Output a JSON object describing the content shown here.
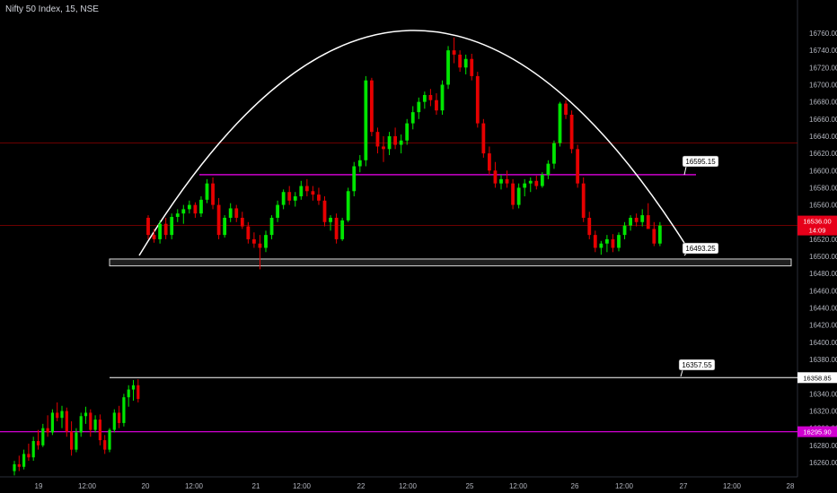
{
  "header": {
    "symbol_title": "Nifty 50 Index, 15, NSE"
  },
  "colors": {
    "up": "#00e600",
    "down": "#e60000",
    "resistance_line": "#cc00cc",
    "support_box": "#d9d9d9",
    "arc": "#ffffff",
    "red_level": "#b30000",
    "current_tag": "#e6001a",
    "magenta_tag": "#d100d1"
  },
  "chart_data": {
    "type": "candlestick",
    "title": "Nifty 50 Index, 15, NSE",
    "y_ticks": [
      16760,
      16740,
      16720,
      16700,
      16680,
      16660,
      16640,
      16620,
      16600,
      16580,
      16560,
      16540,
      16520,
      16500,
      16480,
      16460,
      16440,
      16420,
      16400,
      16380,
      16360,
      16340,
      16320,
      16300,
      16280,
      16260
    ],
    "ylim": [
      16248,
      16782
    ],
    "x_ticks": [
      "19",
      "12:00",
      "20",
      "12:00",
      "21",
      "12:00",
      "22",
      "12:00",
      "25",
      "12:00",
      "26",
      "12:00",
      "27",
      "12:00",
      "28"
    ],
    "annotations": {
      "resistance_line": {
        "value": 16595.15,
        "label": "16595.15"
      },
      "support_zone": {
        "low": 16489,
        "high": 16497,
        "label": "16493.25"
      },
      "upper_white_line": {
        "value": 16358.85,
        "label": "16357.55"
      },
      "magenta_level": {
        "value": 16295.9
      },
      "red_level_upper": {
        "value": 16632
      },
      "red_level_current": {
        "value": 16536
      },
      "arc": "rounding top"
    },
    "price_tags": {
      "current": {
        "value": 16536,
        "label": "16536.00",
        "timer": "14:09"
      },
      "white_level": {
        "value": 16358.85,
        "label": "16358.85"
      },
      "magenta_level": {
        "value": 16295.9,
        "label": "16295.90"
      }
    },
    "candles_early": [
      [
        16250,
        16262,
        16245,
        16258
      ],
      [
        16258,
        16268,
        16250,
        16255
      ],
      [
        16255,
        16275,
        16252,
        16270
      ],
      [
        16270,
        16282,
        16262,
        16266
      ],
      [
        16266,
        16290,
        16262,
        16285
      ],
      [
        16285,
        16298,
        16275,
        16280
      ],
      [
        16280,
        16305,
        16278,
        16300
      ],
      [
        16300,
        16315,
        16290,
        16295
      ],
      [
        16295,
        16322,
        16292,
        16318
      ],
      [
        16318,
        16330,
        16308,
        16312
      ],
      [
        16312,
        16326,
        16300,
        16320
      ],
      [
        16320,
        16324,
        16290,
        16296
      ],
      [
        16296,
        16308,
        16268,
        16275
      ],
      [
        16275,
        16300,
        16272,
        16295
      ],
      [
        16295,
        16318,
        16290,
        16314
      ],
      [
        16314,
        16325,
        16305,
        16318
      ],
      [
        16318,
        16322,
        16290,
        16298
      ],
      [
        16298,
        16315,
        16295,
        16310
      ],
      [
        16310,
        16316,
        16280,
        16286
      ],
      [
        16286,
        16292,
        16270,
        16275
      ],
      [
        16275,
        16300,
        16272,
        16298
      ],
      [
        16298,
        16322,
        16295,
        16318
      ],
      [
        16318,
        16326,
        16300,
        16306
      ],
      [
        16306,
        16340,
        16302,
        16336
      ],
      [
        16336,
        16350,
        16325,
        16345
      ],
      [
        16345,
        16356,
        16332,
        16350
      ],
      [
        16350,
        16357,
        16330,
        16334
      ]
    ],
    "candles_main": [
      [
        16545,
        16548,
        16520,
        16525
      ],
      [
        16525,
        16532,
        16516,
        16520
      ],
      [
        16520,
        16542,
        16515,
        16538
      ],
      [
        16538,
        16545,
        16520,
        16525
      ],
      [
        16525,
        16550,
        16520,
        16546
      ],
      [
        16546,
        16555,
        16540,
        16550
      ],
      [
        16550,
        16560,
        16538,
        16555
      ],
      [
        16555,
        16565,
        16550,
        16560
      ],
      [
        16560,
        16563,
        16545,
        16550
      ],
      [
        16550,
        16570,
        16546,
        16566
      ],
      [
        16566,
        16590,
        16562,
        16585
      ],
      [
        16585,
        16592,
        16555,
        16560
      ],
      [
        16560,
        16568,
        16520,
        16525
      ],
      [
        16525,
        16548,
        16522,
        16545
      ],
      [
        16545,
        16562,
        16540,
        16556
      ],
      [
        16556,
        16560,
        16540,
        16545
      ],
      [
        16545,
        16552,
        16532,
        16535
      ],
      [
        16535,
        16540,
        16515,
        16520
      ],
      [
        16520,
        16528,
        16510,
        16515
      ],
      [
        16515,
        16525,
        16485,
        16510
      ],
      [
        16510,
        16530,
        16505,
        16525
      ],
      [
        16525,
        16548,
        16520,
        16545
      ],
      [
        16545,
        16565,
        16540,
        16560
      ],
      [
        16560,
        16578,
        16555,
        16575
      ],
      [
        16575,
        16582,
        16560,
        16565
      ],
      [
        16565,
        16575,
        16558,
        16570
      ],
      [
        16570,
        16588,
        16566,
        16582
      ],
      [
        16582,
        16590,
        16570,
        16576
      ],
      [
        16576,
        16582,
        16565,
        16572
      ],
      [
        16572,
        16580,
        16560,
        16565
      ],
      [
        16565,
        16570,
        16535,
        16540
      ],
      [
        16540,
        16548,
        16530,
        16545
      ],
      [
        16545,
        16550,
        16515,
        16520
      ],
      [
        16520,
        16545,
        16518,
        16542
      ],
      [
        16542,
        16580,
        16540,
        16576
      ],
      [
        16576,
        16610,
        16570,
        16605
      ],
      [
        16605,
        16618,
        16598,
        16612
      ],
      [
        16612,
        16710,
        16605,
        16705
      ],
      [
        16705,
        16708,
        16640,
        16645
      ],
      [
        16645,
        16650,
        16620,
        16628
      ],
      [
        16628,
        16640,
        16610,
        16625
      ],
      [
        16625,
        16645,
        16618,
        16640
      ],
      [
        16640,
        16650,
        16625,
        16630
      ],
      [
        16630,
        16642,
        16620,
        16635
      ],
      [
        16635,
        16660,
        16630,
        16655
      ],
      [
        16655,
        16675,
        16648,
        16668
      ],
      [
        16668,
        16685,
        16660,
        16680
      ],
      [
        16680,
        16692,
        16672,
        16688
      ],
      [
        16688,
        16695,
        16675,
        16682
      ],
      [
        16682,
        16690,
        16665,
        16670
      ],
      [
        16670,
        16705,
        16665,
        16700
      ],
      [
        16700,
        16745,
        16695,
        16740
      ],
      [
        16740,
        16755,
        16725,
        16735
      ],
      [
        16735,
        16740,
        16715,
        16720
      ],
      [
        16720,
        16735,
        16712,
        16730
      ],
      [
        16730,
        16736,
        16705,
        16710
      ],
      [
        16710,
        16715,
        16650,
        16655
      ],
      [
        16655,
        16660,
        16615,
        16620
      ],
      [
        16620,
        16628,
        16595,
        16600
      ],
      [
        16600,
        16610,
        16580,
        16585
      ],
      [
        16585,
        16595,
        16578,
        16590
      ],
      [
        16590,
        16600,
        16580,
        16585
      ],
      [
        16585,
        16590,
        16555,
        16560
      ],
      [
        16560,
        16585,
        16556,
        16580
      ],
      [
        16580,
        16590,
        16570,
        16585
      ],
      [
        16585,
        16592,
        16575,
        16588
      ],
      [
        16588,
        16594,
        16578,
        16582
      ],
      [
        16582,
        16598,
        16580,
        16595
      ],
      [
        16595,
        16612,
        16590,
        16608
      ],
      [
        16608,
        16635,
        16602,
        16632
      ],
      [
        16632,
        16680,
        16628,
        16678
      ],
      [
        16678,
        16682,
        16660,
        16665
      ],
      [
        16665,
        16670,
        16620,
        16625
      ],
      [
        16625,
        16630,
        16580,
        16585
      ],
      [
        16585,
        16592,
        16540,
        16545
      ],
      [
        16545,
        16552,
        16520,
        16525
      ],
      [
        16525,
        16530,
        16505,
        16510
      ],
      [
        16510,
        16518,
        16502,
        16515
      ],
      [
        16515,
        16525,
        16505,
        16520
      ],
      [
        16520,
        16526,
        16505,
        16510
      ],
      [
        16510,
        16528,
        16506,
        16525
      ],
      [
        16525,
        16540,
        16520,
        16536
      ],
      [
        16536,
        16548,
        16530,
        16545
      ],
      [
        16545,
        16550,
        16535,
        16540
      ],
      [
        16540,
        16555,
        16535,
        16548
      ],
      [
        16548,
        16562,
        16542,
        16532
      ],
      [
        16532,
        16540,
        16512,
        16515
      ],
      [
        16515,
        16540,
        16512,
        16536
      ]
    ]
  }
}
